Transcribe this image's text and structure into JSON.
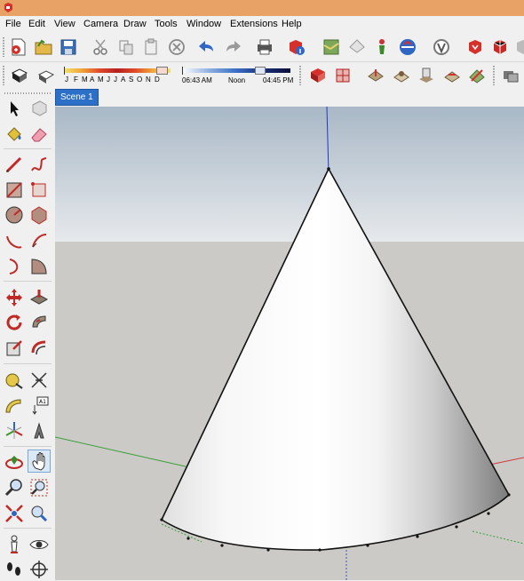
{
  "menu": [
    "File",
    "Edit",
    "View",
    "Camera",
    "Draw",
    "Tools",
    "Window",
    "Extensions",
    "Help"
  ],
  "shadow": {
    "months": [
      "J",
      "F",
      "M",
      "A",
      "M",
      "J",
      "J",
      "A",
      "S",
      "O",
      "N",
      "D"
    ],
    "time_start": "06:43 AM",
    "time_mid": "Noon",
    "time_end": "04:45 PM"
  },
  "scene_tab": "Scene 1",
  "colors": {
    "titlebar": "#e8a266",
    "sky_top": "#a9b8c6",
    "sky_bottom": "#e6e9ec",
    "ground": "#cbcac6",
    "scene_tab": "#2b6fc7"
  },
  "icons": {
    "toolbar1": [
      "new-icon",
      "open-icon",
      "save-icon",
      "cut-icon",
      "copy-icon",
      "paste-icon",
      "erase-icon",
      "undo-icon",
      "redo-icon",
      "print-icon",
      "model-info-icon",
      "map-icon",
      "share-icon",
      "person-icon",
      "warehouse-icon",
      "extension-icon",
      "ruby-icon",
      "component-icon"
    ],
    "toolbar2": [
      "shadow-toggle-icon",
      "fog-icon",
      "styles-icon",
      "sandbox-icon",
      "from-contours-icon",
      "from-scratch-icon",
      "smoove-icon",
      "stamp-icon",
      "drape-icon",
      "flip-edge-icon"
    ],
    "left": [
      "select-icon",
      "component-icon",
      "paint-bucket-icon",
      "eraser-icon",
      "line-icon",
      "freehand-icon",
      "rectangle-icon",
      "rotated-rectangle-icon",
      "circle-icon",
      "polygon-icon",
      "arc-icon",
      "pie-icon",
      "two-point-arc-icon",
      "three-point-arc-icon",
      "move-icon",
      "push-pull-icon",
      "rotate-icon",
      "follow-me-icon",
      "scale-icon",
      "offset-icon",
      "tape-measure-icon",
      "dimension-icon",
      "protractor-icon",
      "text-icon",
      "axes-icon",
      "3d-text-icon",
      "orbit-icon",
      "pan-icon",
      "zoom-icon",
      "zoom-window-icon",
      "zoom-extents-icon",
      "previous-view-icon",
      "position-camera-icon",
      "look-around-icon",
      "walk-icon",
      "section-plane-icon"
    ]
  }
}
